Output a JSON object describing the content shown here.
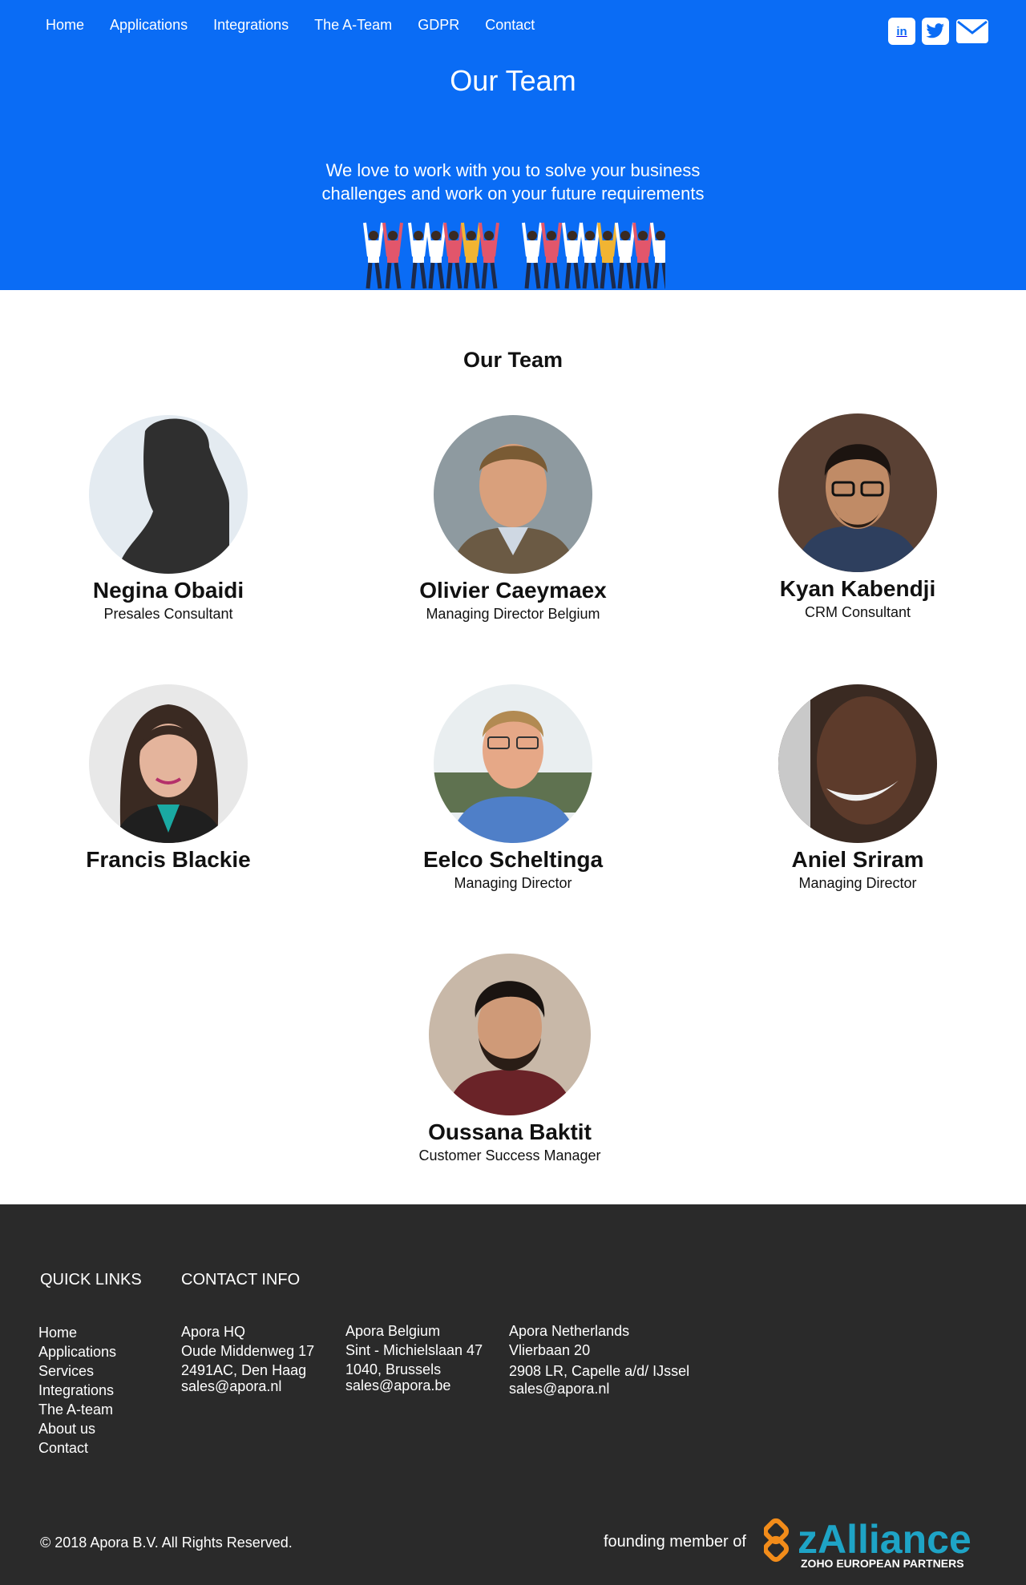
{
  "nav": {
    "items": [
      "Home",
      "Applications",
      "Integrations",
      "The A-Team",
      "GDPR",
      "Contact"
    ]
  },
  "social": {
    "linkedin_label": "in",
    "icons": [
      "linkedin-icon",
      "twitter-icon",
      "mail-icon"
    ]
  },
  "hero": {
    "title": "Our Team",
    "subtitle_line1": "We love to work with you to solve your business",
    "subtitle_line2": "challenges and work on your future requirements",
    "background_color": "#0a6cf5"
  },
  "team": {
    "title": "Our Team",
    "members": [
      {
        "name": "Negina Obaidi",
        "role": "Presales Consultant"
      },
      {
        "name": "Olivier Caeymaex",
        "role": "Managing Director Belgium"
      },
      {
        "name": "Kyan Kabendji",
        "role": "CRM Consultant"
      },
      {
        "name": "Francis Blackie",
        "role": ""
      },
      {
        "name": "Eelco Scheltinga",
        "role": "Managing Director"
      },
      {
        "name": "Aniel Sriram",
        "role": "Managing Director"
      },
      {
        "name": "Oussana Baktit",
        "role": "Customer Success Manager"
      }
    ]
  },
  "footer": {
    "quick_links_title": "QUICK LINKS",
    "contact_info_title": "CONTACT INFO",
    "quick_links": [
      "Home",
      "Applications",
      "Services",
      "Integrations",
      "The A-team",
      "About us",
      "Contact"
    ],
    "offices": [
      {
        "name": "Apora HQ",
        "street": "Oude Middenweg 17",
        "city": "2491AC, Den Haag",
        "email": "sales@apora.nl"
      },
      {
        "name": "Apora Belgium",
        "street": "Sint - Michielslaan 47",
        "city": "1040, Brussels",
        "email": "sales@apora.be"
      },
      {
        "name": "Apora Netherlands",
        "street": "Vlierbaan 20",
        "city": "2908 LR, Capelle a/d/ IJssel",
        "email": "sales@apora.nl"
      }
    ],
    "copyright": "© 2018 Apora B.V. All Rights Reserved.",
    "founding_text": "founding member of",
    "logo_word": "zAlliance",
    "logo_tagline": "ZOHO EUROPEAN PARTNERS",
    "background_color": "#2a2a2a"
  }
}
